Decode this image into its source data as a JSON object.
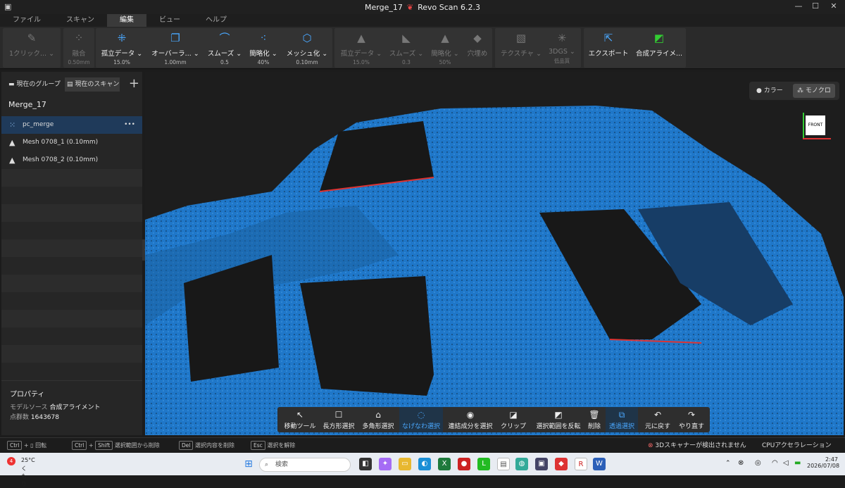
{
  "window": {
    "title": "Merge_17",
    "app_name": "Revo Scan 6.2.3"
  },
  "menu": [
    "ファイル",
    "スキャン",
    "編集",
    "ビュー",
    "ヘルプ"
  ],
  "menu_active_index": 2,
  "toolbar": {
    "one_click": {
      "label": "1クリック..."
    },
    "fusion": {
      "label": "融合",
      "value": "0.50mm"
    },
    "isolated": {
      "label": "孤立データ",
      "value": "15.0%"
    },
    "overlap": {
      "label": "オーバーラ...",
      "value": "1.00mm"
    },
    "smooth": {
      "label": "スムーズ",
      "value": "0.5"
    },
    "simplify": {
      "label": "簡略化",
      "value": "40%"
    },
    "meshing": {
      "label": "メッシュ化",
      "value": "0.10mm"
    },
    "m_isolated": {
      "label": "孤立データ",
      "value": "15.0%"
    },
    "m_smooth": {
      "label": "スムーズ",
      "value": "0.3"
    },
    "m_simplify": {
      "label": "簡略化",
      "value": "50%"
    },
    "fill_holes": {
      "label": "穴埋め"
    },
    "texture": {
      "label": "テクスチャ"
    },
    "gs3d": {
      "label": "3DGS",
      "value": "低品質"
    },
    "export": {
      "label": "エクスポート"
    },
    "align": {
      "label": "合成アライメ..."
    }
  },
  "left": {
    "tab_group": "現在のグループ",
    "tab_scan": "現在のスキャン",
    "group_name": "Merge_17",
    "items": [
      {
        "label": "pc_merge",
        "icon": "point-cloud-icon"
      },
      {
        "label": "Mesh 0708_1 (0.10mm)",
        "icon": "mesh-icon"
      },
      {
        "label": "Mesh 0708_2 (0.10mm)",
        "icon": "mesh-icon"
      }
    ],
    "more": "•••",
    "props_title": "プロパティ",
    "model_source_label": "モデルソース",
    "model_source_value": "合成アライメント",
    "point_count_label": "点群数",
    "point_count_value": "1643678"
  },
  "viewport": {
    "color_label": "カラー",
    "mono_label": "モノクロ",
    "cube_label": "FRONT"
  },
  "selection_tools": [
    {
      "label": "移動ツール",
      "icon": "↖"
    },
    {
      "label": "長方形選択",
      "icon": "☐"
    },
    {
      "label": "多角形選択",
      "icon": "⌂"
    },
    {
      "label": "なげなわ選択",
      "icon": "◌"
    },
    {
      "label": "連結成分を選択",
      "icon": "◉"
    },
    {
      "label": "クリップ",
      "icon": "◪"
    },
    {
      "label": "選択範囲を反転",
      "icon": "◩"
    },
    {
      "label": "削除",
      "icon": "🗑"
    },
    {
      "label": "透過選択",
      "icon": "⧉"
    },
    {
      "label": "元に戻す",
      "icon": "↶"
    },
    {
      "label": "やり直す",
      "icon": "↷"
    }
  ],
  "selection_active": [
    3,
    8
  ],
  "status": {
    "k1": "Ctrl",
    "t1": "回転",
    "k2": "Ctrl",
    "k2b": "Shift",
    "t2": "選択範囲から削除",
    "k3": "Del",
    "t3": "選択内容を削除",
    "k4": "Esc",
    "t4": "選択を解除",
    "warning": "3Dスキャナーが検出されません",
    "cpu": "CPUアクセラレーション"
  },
  "taskbar": {
    "weather_temp": "25°C",
    "weather_text": "くもり",
    "badge": "4",
    "search": "検索",
    "time": "2:47",
    "date": "2026/07/08"
  },
  "colors": {
    "accent": "#4aa8ff",
    "model": "#1f77c9",
    "selected_row": "#1f3a5a"
  }
}
